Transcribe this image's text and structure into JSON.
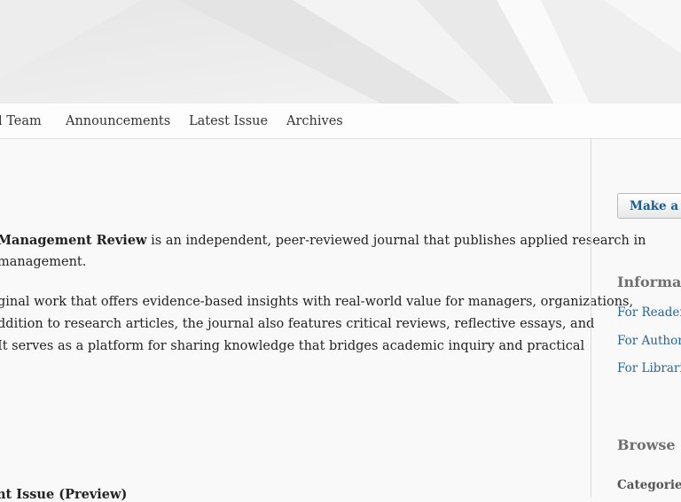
{
  "nav": {
    "items": [
      {
        "label": "l Team"
      },
      {
        "label": "Announcements"
      },
      {
        "label": "Latest Issue"
      },
      {
        "label": "Archives"
      }
    ]
  },
  "main": {
    "para1": {
      "journal_name": "Management Review",
      "line1_rest": " is an independent, peer-reviewed journal that publishes applied research in",
      "line2": "management."
    },
    "para2": {
      "line1": "ginal work that offers evidence-based insights with real-world value for managers, organizations,",
      "line2": "ddition to research articles, the journal also features critical reviews, reflective essays, and",
      "line3": "It serves as a platform for sharing knowledge that bridges academic inquiry and practical"
    },
    "issue_heading": "nt Issue (Preview)"
  },
  "sidebar": {
    "submit_button": "Make a Submission",
    "information": {
      "title": "Information",
      "links": [
        "For Readers",
        "For Authors",
        "For Librarians"
      ]
    },
    "browse": {
      "title": "Browse",
      "categories_label": "Categories"
    }
  },
  "colors": {
    "link": "#2a6496",
    "button_text": "#1e5b8a",
    "sidebar_heading": "#707070"
  }
}
